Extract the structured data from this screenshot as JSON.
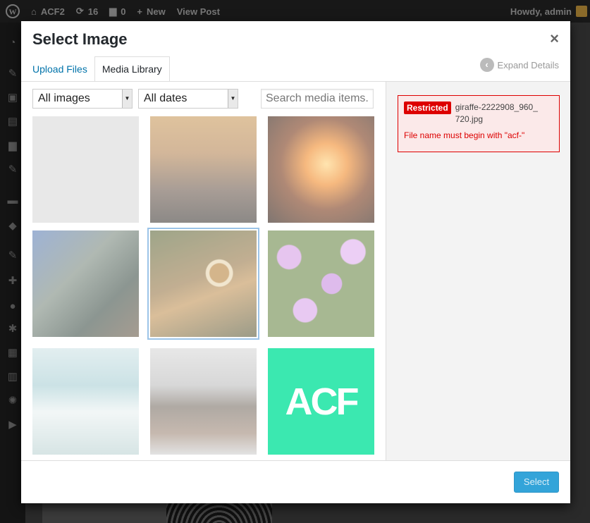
{
  "adminbar": {
    "site_name": "ACF2",
    "updates_count": "16",
    "comments_count": "0",
    "new_label": "New",
    "view_post_label": "View Post",
    "howdy_label": "Howdy, admin"
  },
  "modal": {
    "title": "Select Image",
    "close_icon": "×",
    "tabs": [
      {
        "label": "Upload Files"
      },
      {
        "label": "Media Library"
      }
    ],
    "expand_details_label": "Expand Details",
    "filters": {
      "type_selected": "All images",
      "date_selected": "All dates"
    },
    "search_placeholder": "Search media items..."
  },
  "media_grid": [
    {
      "subject": "blank"
    },
    {
      "subject": "city skyline at sunset"
    },
    {
      "subject": "fire"
    },
    {
      "subject": "equestrian statue"
    },
    {
      "subject": "giraffe",
      "selected": true
    },
    {
      "subject": "purple flowers"
    },
    {
      "subject": "ocean waves"
    },
    {
      "subject": "paint brushes"
    },
    {
      "subject": "acf-logo",
      "logo_text": "ACF"
    }
  ],
  "sidebar": {
    "notice": {
      "badge": "Restricted",
      "filename": "giraffe-2222908_960_720.jpg",
      "message": "File name must begin with \"acf-\""
    }
  },
  "toolbar": {
    "select_label": "Select"
  },
  "colors": {
    "accent": "#0073aa",
    "restricted": "#dd0000",
    "acf_green": "#3be8b0",
    "select_button": "#33a4d9"
  }
}
